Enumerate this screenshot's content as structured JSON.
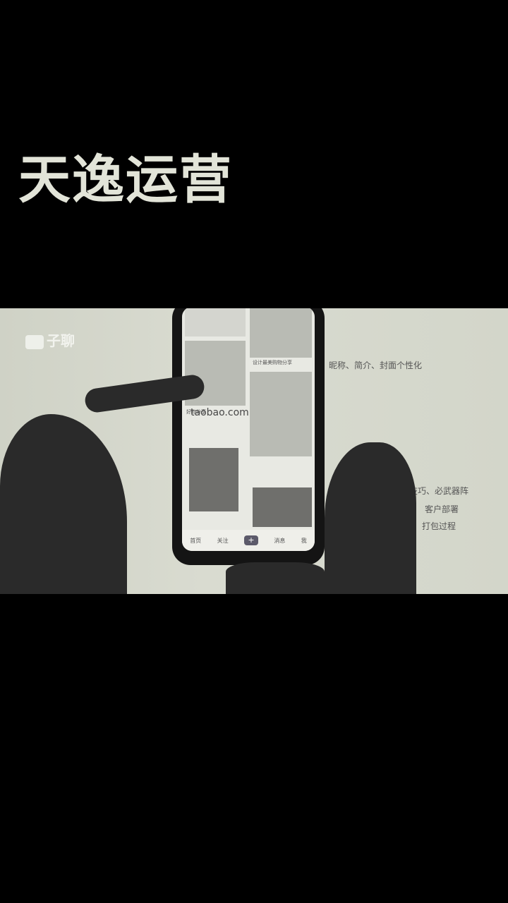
{
  "overlay": {
    "title": "天逸运营"
  },
  "slide": {
    "logo_text": "子聊",
    "lines": [
      "昵称、简介、封面个性化",
      "使用技巧、必武器阵",
      "客户部署",
      "打包过程"
    ]
  },
  "phone": {
    "watermark": "taobao.com",
    "captions": [
      "设计最美购物分享",
      "好物分享"
    ],
    "tabs": [
      "首页",
      "关注",
      "+",
      "消息",
      "我"
    ]
  }
}
